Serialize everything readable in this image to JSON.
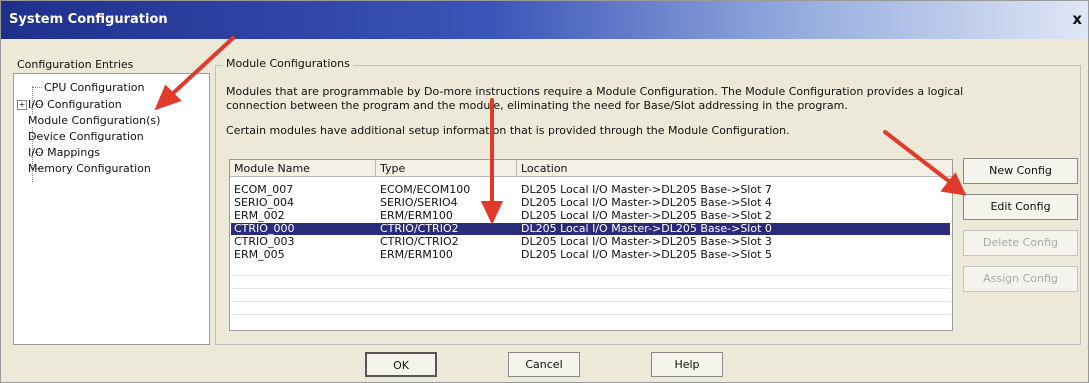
{
  "window": {
    "title": "System Configuration",
    "close_glyph": "x"
  },
  "tree": {
    "heading": "Configuration Entries",
    "items": [
      {
        "label": "CPU Configuration"
      },
      {
        "label": "I/O Configuration",
        "expander": "+"
      },
      {
        "label": "Module Configuration(s)"
      },
      {
        "label": "Device Configuration"
      },
      {
        "label": "I/O Mappings"
      },
      {
        "label": "Memory Configuration"
      }
    ]
  },
  "module_configs": {
    "group_label": "Module Configurations",
    "description": "Modules that are programmable by Do-more instructions require a Module Configuration. The Module Configuration provides a logical connection between the program and the module, eliminating the need for Base/Slot addressing in the program.",
    "note": "Certain modules have additional setup information that is provided through the Module Configuration.",
    "columns": [
      "Module Name",
      "Type",
      "Location"
    ],
    "rows": [
      {
        "name": "ECOM_007",
        "type": "ECOM/ECOM100",
        "location": "DL205 Local I/O Master->DL205 Base->Slot 7"
      },
      {
        "name": "SERIO_004",
        "type": "SERIO/SERIO4",
        "location": "DL205 Local I/O Master->DL205 Base->Slot 4"
      },
      {
        "name": "ERM_002",
        "type": "ERM/ERM100",
        "location": "DL205 Local I/O Master->DL205 Base->Slot 2"
      },
      {
        "name": "CTRIO_000",
        "type": "CTRIO/CTRIO2",
        "location": "DL205 Local I/O Master->DL205 Base->Slot 0"
      },
      {
        "name": "CTRIO_003",
        "type": "CTRIO/CTRIO2",
        "location": "DL205 Local I/O Master->DL205 Base->Slot 3"
      },
      {
        "name": "ERM_005",
        "type": "ERM/ERM100",
        "location": "DL205 Local I/O Master->DL205 Base->Slot 5"
      }
    ],
    "selected_row": "CTRIO_000"
  },
  "side_buttons": {
    "new": "New Config",
    "edit": "Edit Config",
    "delete": "Delete Config",
    "assign": "Assign Config"
  },
  "footer": {
    "ok": "OK",
    "cancel": "Cancel",
    "help": "Help"
  },
  "colors": {
    "title_bar": "#1f2f8c",
    "selection": "#2b2b7c",
    "annotation_arrow": "#e23a2a",
    "dialog_bg": "#ece9d8"
  }
}
